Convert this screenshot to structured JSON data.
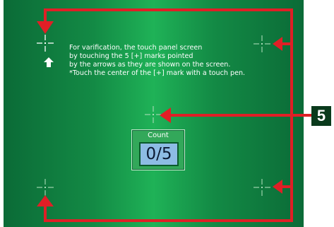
{
  "instructions": {
    "line1": "For varification, the touch panel screen",
    "line2": " by touching the 5 [+] marks pointed",
    "line3": " by the arrows as they are shown on the screen.",
    "line4": "*Touch the center of the [+] mark with a touch pen."
  },
  "counter": {
    "label": "Count",
    "value": "0/5"
  },
  "callout": {
    "step_number": "5"
  },
  "colors": {
    "panel_green": "#138a45",
    "arrow_red": "#e01f26",
    "count_value_bg": "#8dbce4"
  },
  "icons": {
    "target_marks": "crosshair-icon",
    "pointer": "arrow-icon",
    "up_indicator": "up-arrow-icon"
  }
}
